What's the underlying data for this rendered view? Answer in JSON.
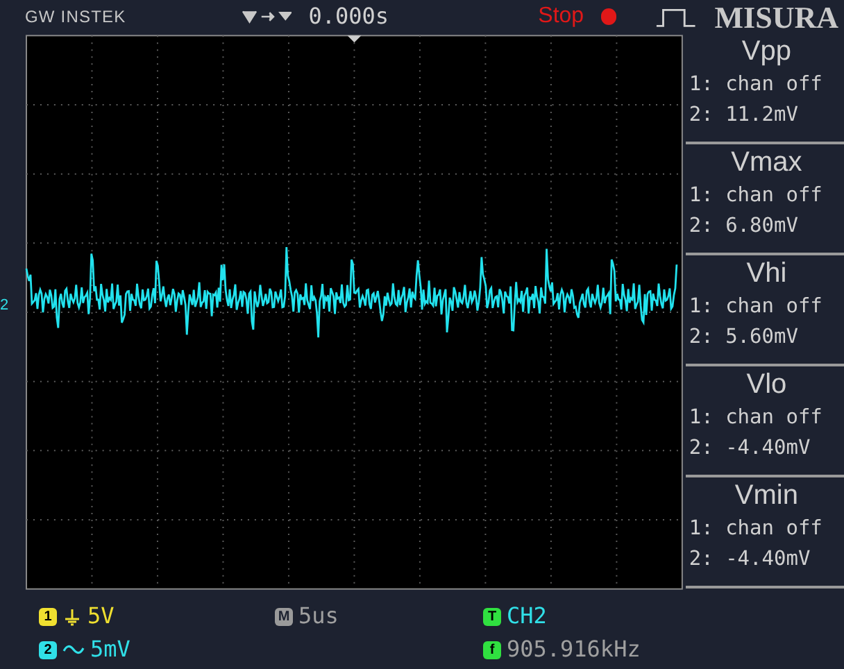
{
  "header": {
    "brand": "GW INSTEK",
    "timebase_offset": "0.000s",
    "run_state": "Stop",
    "title": "MISURA"
  },
  "waveform": {
    "marker": "2"
  },
  "measurements": [
    {
      "title": "Vpp",
      "lines": [
        "1: chan off",
        "2: 11.2mV"
      ]
    },
    {
      "title": "Vmax",
      "lines": [
        "1: chan off",
        "2: 6.80mV"
      ]
    },
    {
      "title": "Vhi",
      "lines": [
        "1: chan off",
        "2: 5.60mV"
      ]
    },
    {
      "title": "Vlo",
      "lines": [
        "1: chan off",
        "2: -4.40mV"
      ]
    },
    {
      "title": "Vmin",
      "lines": [
        "1: chan off",
        "2: -4.40mV"
      ]
    }
  ],
  "channels": [
    {
      "badge": "1",
      "kind": "dc",
      "scale": "5V",
      "color": "#f0e030"
    },
    {
      "badge": "2",
      "kind": "ac",
      "scale": "5mV",
      "color": "#30e0e8"
    }
  ],
  "timebase": {
    "badge": "M",
    "value": "5us"
  },
  "trigger": {
    "badge": "T",
    "source": "CH2"
  },
  "frequency": {
    "badge": "f",
    "value": "905.916kHz"
  }
}
